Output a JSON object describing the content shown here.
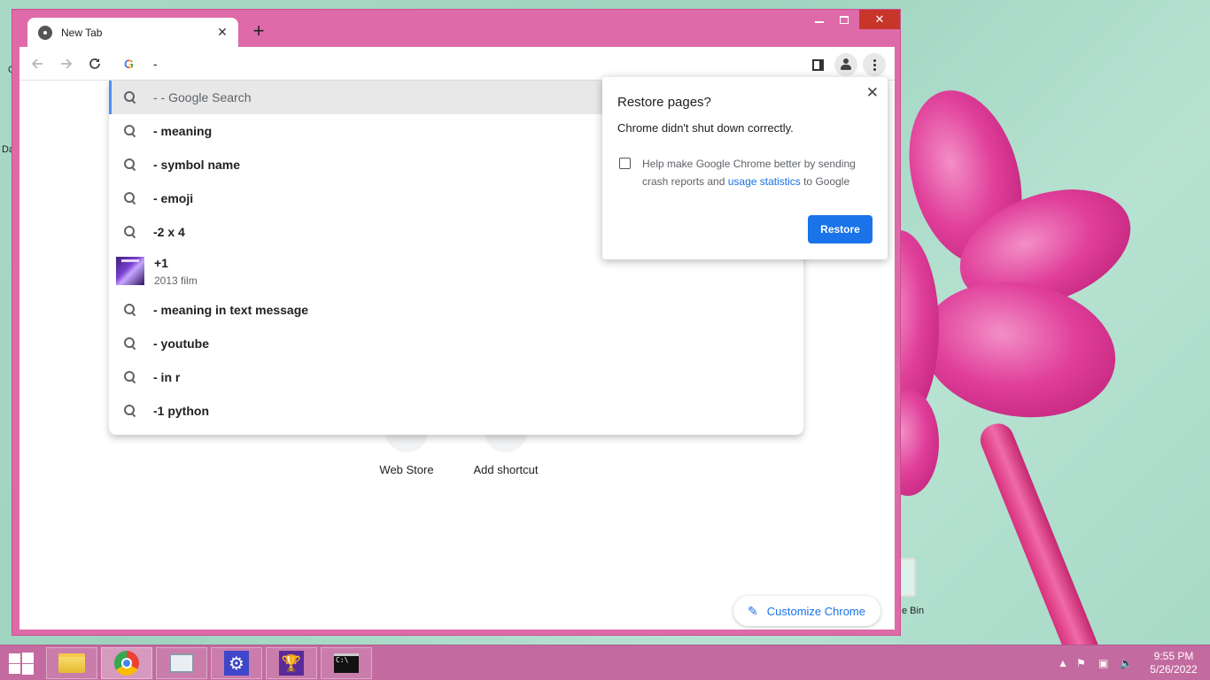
{
  "desktop": {
    "left_labels": [
      "C",
      "Da"
    ],
    "recycle_bin_label": "e Bin"
  },
  "browser": {
    "tab": {
      "title": "New Tab",
      "close": "✕"
    },
    "new_tab_symbol": "+",
    "window_controls": {
      "close": "✕"
    },
    "omnibox": {
      "value": "-"
    },
    "suggestions": [
      {
        "text": "- - Google Search",
        "selected": true
      },
      {
        "text": "- meaning"
      },
      {
        "text": "- symbol name"
      },
      {
        "text": "- emoji"
      },
      {
        "text": "-2 x 4"
      },
      {
        "title": "+1",
        "subtitle": "2013 film"
      },
      {
        "text": "- meaning in text message"
      },
      {
        "text": "- youtube"
      },
      {
        "text": "- in r"
      },
      {
        "text": "-1 python"
      }
    ],
    "shortcuts": [
      {
        "label": "Web Store"
      },
      {
        "label": "Add shortcut"
      }
    ],
    "customize_label": "Customize Chrome",
    "restore_dialog": {
      "title": "Restore pages?",
      "message": "Chrome didn't shut down correctly.",
      "help_prefix": "Help make Google Chrome better by sending crash reports and ",
      "help_link": "usage statistics",
      "help_suffix": " to Google",
      "button": "Restore"
    }
  },
  "taskbar": {
    "time": "9:55 PM",
    "date": "5/26/2022",
    "tray_up": "▲"
  }
}
